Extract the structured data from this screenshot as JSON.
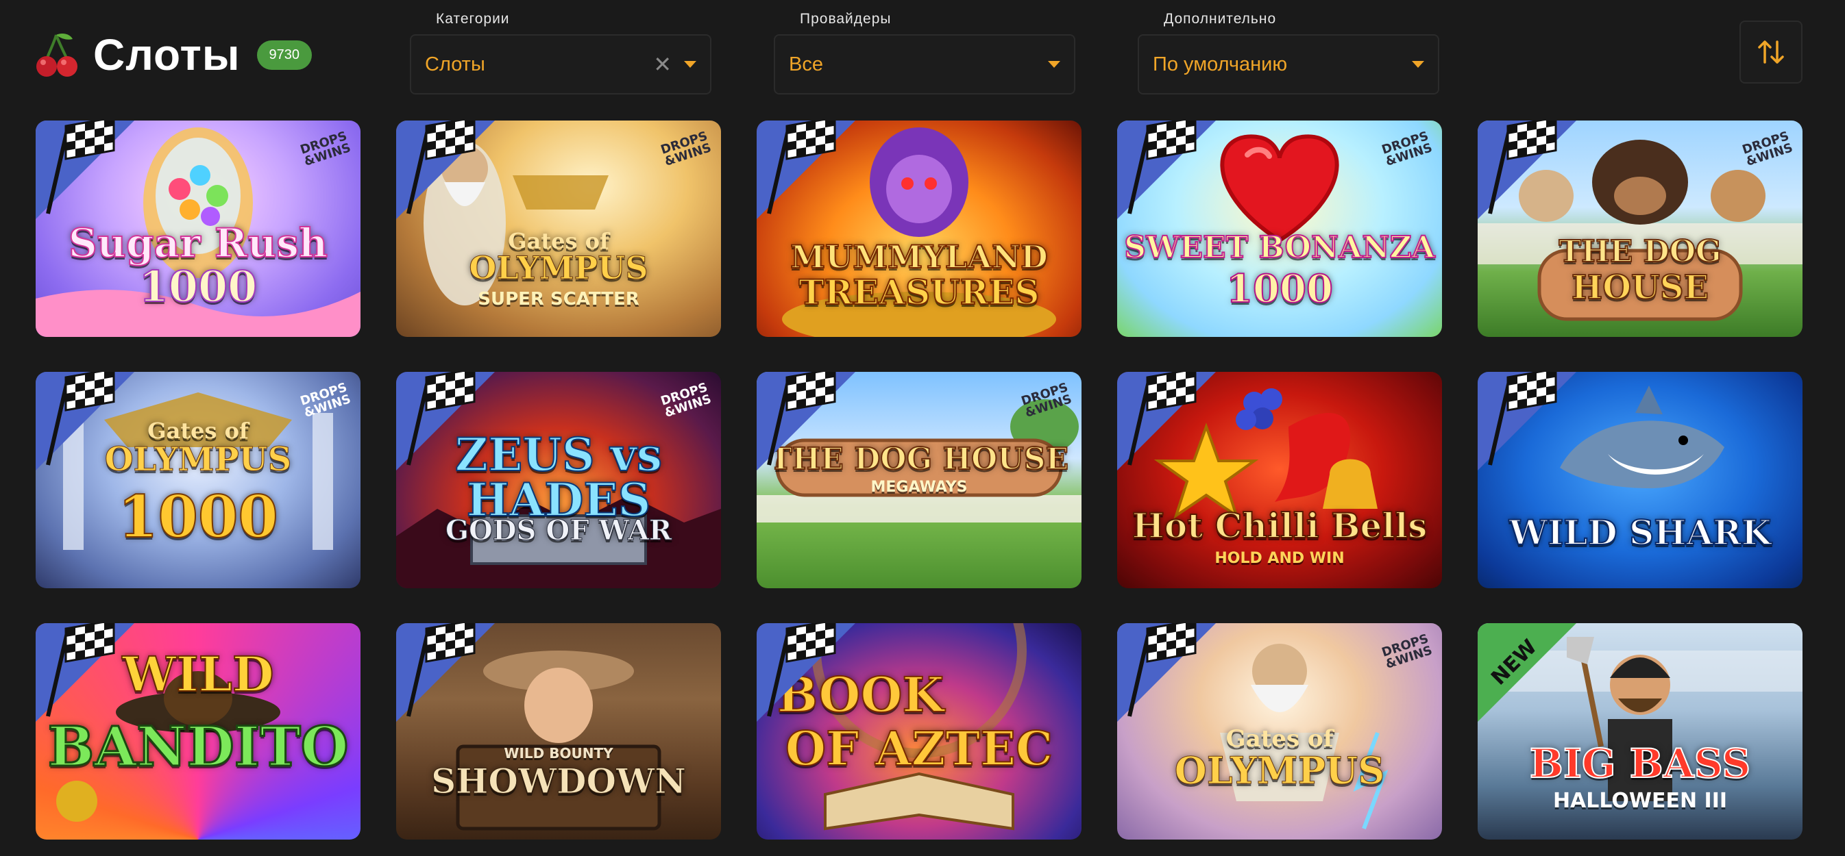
{
  "header": {
    "title": "Слоты",
    "count": "9730"
  },
  "filters": {
    "category": {
      "label": "Категории",
      "value": "Слоты"
    },
    "provider": {
      "label": "Провайдеры",
      "value": "Все"
    },
    "extra": {
      "label": "Дополнительно",
      "value": "По умолчанию"
    }
  },
  "badges": {
    "drops_wins_top": "DROPS",
    "drops_wins_bottom": "&WINS",
    "new": "NEW"
  },
  "games": [
    {
      "title_top": "Sugar Rush",
      "title_bottom": "1000"
    },
    {
      "title_top": "Gates of",
      "title_mid": "OLYMPUS",
      "title_bottom": "SUPER SCATTER"
    },
    {
      "title_top": "MUMMYLAND",
      "title_bottom": "TREASURES"
    },
    {
      "title_top": "SWEET BONANZA",
      "title_bottom": "1000"
    },
    {
      "title_top": "THE DOG",
      "title_bottom": "HOUSE"
    },
    {
      "title_top": "Gates of",
      "title_mid": "OLYMPUS",
      "title_bottom": "1000"
    },
    {
      "title_top": "ZEUS vs HADES",
      "title_bottom": "GODS OF WAR"
    },
    {
      "title_top": "THE DOG HOUSE",
      "title_bottom": "MEGAWAYS"
    },
    {
      "title_top": "Hot Chilli Bells",
      "title_bottom": "HOLD AND WIN"
    },
    {
      "title_top": "WILD SHARK"
    },
    {
      "title_top": "WILD",
      "title_bottom": "BANDITO"
    },
    {
      "title_top": "WILD BOUNTY",
      "title_bottom": "SHOWDOWN"
    },
    {
      "title_top": "BOOK",
      "title_bottom": "OF AZTEC"
    },
    {
      "title_top": "Gates of",
      "title_mid": "OLYMPUS"
    },
    {
      "title_top": "BIG BASS",
      "title_bottom": "HALLOWEEN III"
    }
  ]
}
